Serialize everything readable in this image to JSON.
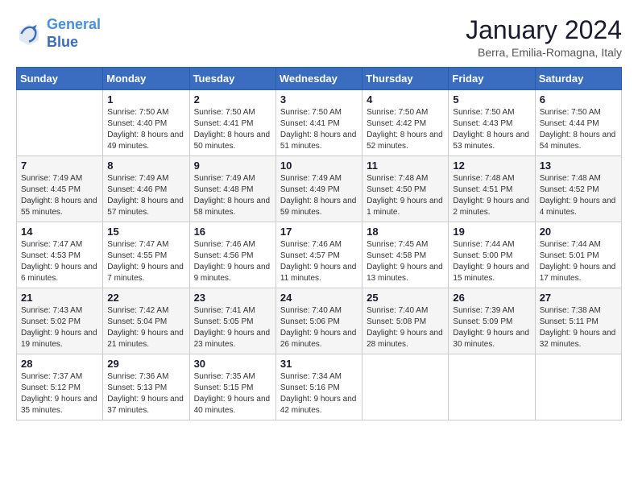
{
  "header": {
    "logo": {
      "line1": "General",
      "line2": "Blue"
    },
    "title": "January 2024",
    "subtitle": "Berra, Emilia-Romagna, Italy"
  },
  "days_of_week": [
    "Sunday",
    "Monday",
    "Tuesday",
    "Wednesday",
    "Thursday",
    "Friday",
    "Saturday"
  ],
  "weeks": [
    [
      {
        "day": "",
        "info": ""
      },
      {
        "day": "1",
        "info": "Sunrise: 7:50 AM\nSunset: 4:40 PM\nDaylight: 8 hours\nand 49 minutes."
      },
      {
        "day": "2",
        "info": "Sunrise: 7:50 AM\nSunset: 4:41 PM\nDaylight: 8 hours\nand 50 minutes."
      },
      {
        "day": "3",
        "info": "Sunrise: 7:50 AM\nSunset: 4:41 PM\nDaylight: 8 hours\nand 51 minutes."
      },
      {
        "day": "4",
        "info": "Sunrise: 7:50 AM\nSunset: 4:42 PM\nDaylight: 8 hours\nand 52 minutes."
      },
      {
        "day": "5",
        "info": "Sunrise: 7:50 AM\nSunset: 4:43 PM\nDaylight: 8 hours\nand 53 minutes."
      },
      {
        "day": "6",
        "info": "Sunrise: 7:50 AM\nSunset: 4:44 PM\nDaylight: 8 hours\nand 54 minutes."
      }
    ],
    [
      {
        "day": "7",
        "info": "Sunrise: 7:49 AM\nSunset: 4:45 PM\nDaylight: 8 hours\nand 55 minutes."
      },
      {
        "day": "8",
        "info": "Sunrise: 7:49 AM\nSunset: 4:46 PM\nDaylight: 8 hours\nand 57 minutes."
      },
      {
        "day": "9",
        "info": "Sunrise: 7:49 AM\nSunset: 4:48 PM\nDaylight: 8 hours\nand 58 minutes."
      },
      {
        "day": "10",
        "info": "Sunrise: 7:49 AM\nSunset: 4:49 PM\nDaylight: 8 hours\nand 59 minutes."
      },
      {
        "day": "11",
        "info": "Sunrise: 7:48 AM\nSunset: 4:50 PM\nDaylight: 9 hours\nand 1 minute."
      },
      {
        "day": "12",
        "info": "Sunrise: 7:48 AM\nSunset: 4:51 PM\nDaylight: 9 hours\nand 2 minutes."
      },
      {
        "day": "13",
        "info": "Sunrise: 7:48 AM\nSunset: 4:52 PM\nDaylight: 9 hours\nand 4 minutes."
      }
    ],
    [
      {
        "day": "14",
        "info": "Sunrise: 7:47 AM\nSunset: 4:53 PM\nDaylight: 9 hours\nand 6 minutes."
      },
      {
        "day": "15",
        "info": "Sunrise: 7:47 AM\nSunset: 4:55 PM\nDaylight: 9 hours\nand 7 minutes."
      },
      {
        "day": "16",
        "info": "Sunrise: 7:46 AM\nSunset: 4:56 PM\nDaylight: 9 hours\nand 9 minutes."
      },
      {
        "day": "17",
        "info": "Sunrise: 7:46 AM\nSunset: 4:57 PM\nDaylight: 9 hours\nand 11 minutes."
      },
      {
        "day": "18",
        "info": "Sunrise: 7:45 AM\nSunset: 4:58 PM\nDaylight: 9 hours\nand 13 minutes."
      },
      {
        "day": "19",
        "info": "Sunrise: 7:44 AM\nSunset: 5:00 PM\nDaylight: 9 hours\nand 15 minutes."
      },
      {
        "day": "20",
        "info": "Sunrise: 7:44 AM\nSunset: 5:01 PM\nDaylight: 9 hours\nand 17 minutes."
      }
    ],
    [
      {
        "day": "21",
        "info": "Sunrise: 7:43 AM\nSunset: 5:02 PM\nDaylight: 9 hours\nand 19 minutes."
      },
      {
        "day": "22",
        "info": "Sunrise: 7:42 AM\nSunset: 5:04 PM\nDaylight: 9 hours\nand 21 minutes."
      },
      {
        "day": "23",
        "info": "Sunrise: 7:41 AM\nSunset: 5:05 PM\nDaylight: 9 hours\nand 23 minutes."
      },
      {
        "day": "24",
        "info": "Sunrise: 7:40 AM\nSunset: 5:06 PM\nDaylight: 9 hours\nand 26 minutes."
      },
      {
        "day": "25",
        "info": "Sunrise: 7:40 AM\nSunset: 5:08 PM\nDaylight: 9 hours\nand 28 minutes."
      },
      {
        "day": "26",
        "info": "Sunrise: 7:39 AM\nSunset: 5:09 PM\nDaylight: 9 hours\nand 30 minutes."
      },
      {
        "day": "27",
        "info": "Sunrise: 7:38 AM\nSunset: 5:11 PM\nDaylight: 9 hours\nand 32 minutes."
      }
    ],
    [
      {
        "day": "28",
        "info": "Sunrise: 7:37 AM\nSunset: 5:12 PM\nDaylight: 9 hours\nand 35 minutes."
      },
      {
        "day": "29",
        "info": "Sunrise: 7:36 AM\nSunset: 5:13 PM\nDaylight: 9 hours\nand 37 minutes."
      },
      {
        "day": "30",
        "info": "Sunrise: 7:35 AM\nSunset: 5:15 PM\nDaylight: 9 hours\nand 40 minutes."
      },
      {
        "day": "31",
        "info": "Sunrise: 7:34 AM\nSunset: 5:16 PM\nDaylight: 9 hours\nand 42 minutes."
      },
      {
        "day": "",
        "info": ""
      },
      {
        "day": "",
        "info": ""
      },
      {
        "day": "",
        "info": ""
      }
    ]
  ]
}
